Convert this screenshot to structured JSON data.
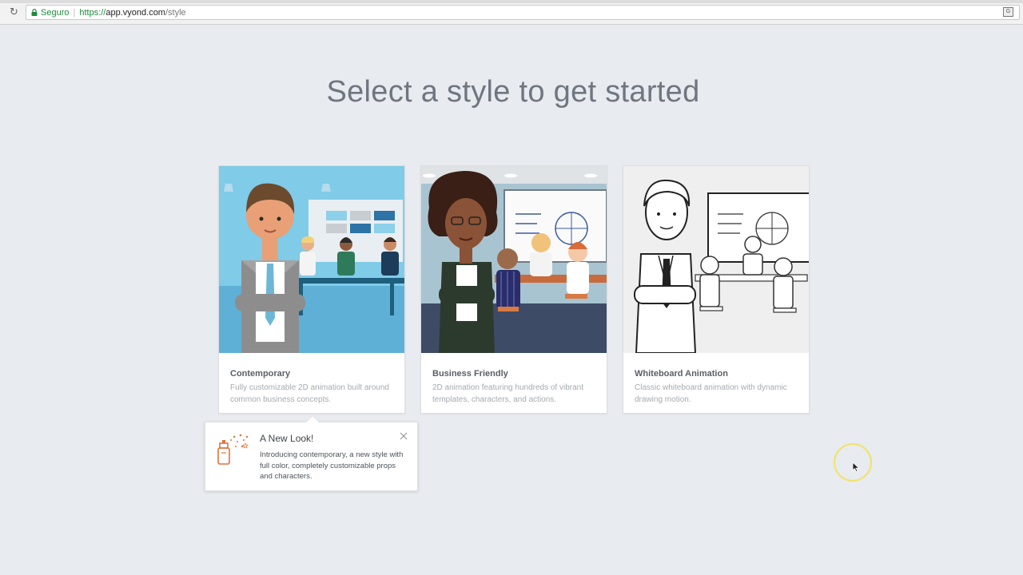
{
  "browser": {
    "secure_label": "Seguro",
    "url_scheme": "https://",
    "url_host": "app.vyond.com",
    "url_path": "/style",
    "icons": [
      "reload-icon",
      "lock-icon",
      "translate-icon"
    ]
  },
  "page": {
    "title": "Select a style to get started"
  },
  "styles": [
    {
      "title": "Contemporary",
      "description": "Fully customizable 2D animation built around common business concepts."
    },
    {
      "title": "Business Friendly",
      "description": "2D animation featuring hundreds of vibrant templates, characters, and actions."
    },
    {
      "title": "Whiteboard Animation",
      "description": "Classic whiteboard animation with dynamic drawing motion."
    }
  ],
  "popup": {
    "title": "A New Look!",
    "text": "Introducing contemporary, a new style with full color, completely customizable props and characters.",
    "icon": "spray-can-icon"
  },
  "colors": {
    "background": "#e8ebef",
    "accent_orange": "#e0733e",
    "secure_green": "#1e8a3c",
    "cursor_ring": "#f0e36a"
  }
}
